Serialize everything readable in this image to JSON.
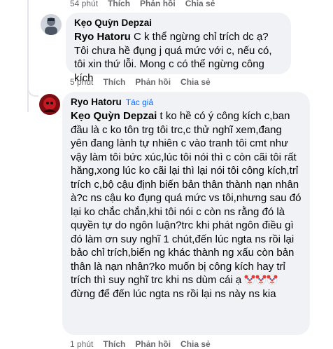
{
  "top_actions": {
    "time": "54 phút",
    "like": "Thích",
    "reply": "Phản hồi",
    "share": "Chia sẻ"
  },
  "comments": [
    {
      "author": "Kẹo Quỳn Depzai",
      "mention": "Ryo Hatoru",
      "text": " C k thể ngừng chỉ trích dc ạ? Tôi chưa hề đụng j quá mức với c, nếu có, tôi xin thứ lỗi. Mong c có thể ngừng công kích",
      "actions": {
        "time": "5 phút",
        "like": "Thích",
        "reply": "Phản hồi",
        "share": "Chia sẻ"
      }
    },
    {
      "author": "Ryo Hatoru",
      "badge": "Tác giả",
      "mention": "Kẹo Quỳn Depzai",
      "text": " t ko hề có ý công kích c,ban đầu là c ko tôn trg tôi trc,c thử nghĩ xem,đang yên đang lành tự nhiên c vào tranh tôi cmt như vậy làm tôi bức xúc,lúc tôi nói thì c còn cãi tôi rất hăng,xong lúc ko cãi lại thì lại nói tôi công kích,trỉ trích c,bộ cậu định biến bản thân thành nạn nhân à?c ns cậu ko đụng quá mức vs tôi,nhưng sau đó lại ko chắc chắn,khi tôi nói c còn ns rằng đó là quyền tự do ngôn luận?trc khi phát ngôn điều gì đó làm ơn suy nghĩ 1 chút,đến lúc ngta ns rồi lại bảo chỉ trích,biến ng khác thành ng xấu còn bản thân là nạn nhân?ko muốn bị công kích hay trỉ trích thì suy nghĩ trc khi ns dùm cái ạ",
      "text_after": "đừng để đến lúc ngta ns rồi lại ns này ns kia",
      "emojis": [
        "clown-emoji",
        "clown-emoji",
        "clown-emoji"
      ],
      "actions": {
        "time": "1 phút",
        "like": "Thích",
        "reply": "Phản hồi",
        "share": "Chia sẻ"
      }
    }
  ]
}
